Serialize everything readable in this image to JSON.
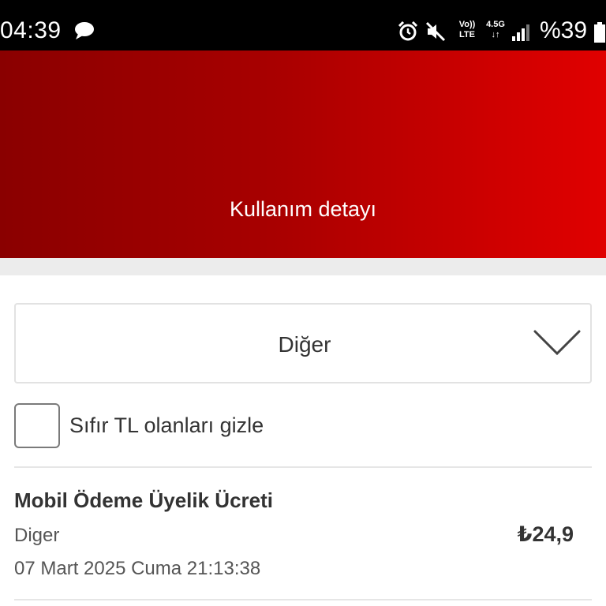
{
  "status_bar": {
    "time": "04:39",
    "network_top": "4.5G",
    "network_bottom": "↓↑",
    "volte_top": "Vo))",
    "volte_bottom": "LTE",
    "battery": "%39",
    "icons": [
      "chat-bubble-icon",
      "alarm-icon",
      "mute-icon",
      "volte-icon",
      "network-4.5g-icon",
      "signal-icon",
      "battery-icon"
    ]
  },
  "header": {
    "title": "Kullanım detayı",
    "gradient_colors": [
      "#8a0000",
      "#e00000"
    ]
  },
  "filter": {
    "selected": "Diğer"
  },
  "zero_filter": {
    "label": "Sıfır TL olanları gizle",
    "checked": false
  },
  "items": [
    {
      "title": "Mobil Ödeme Üyelik Ücreti",
      "category": "Diger",
      "date": "07 Mart 2025 Cuma 21:13:38",
      "amount": "₺24,9"
    }
  ]
}
